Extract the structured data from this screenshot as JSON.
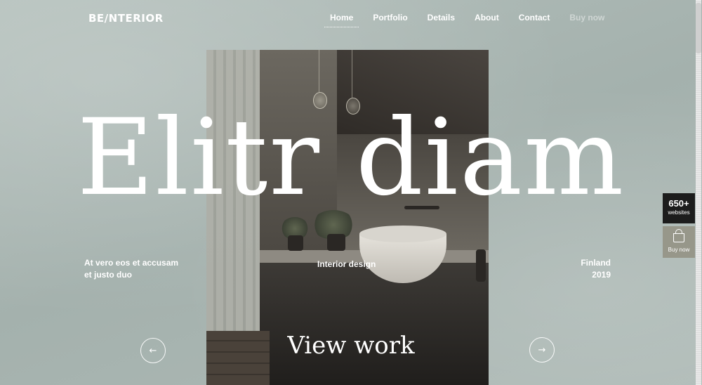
{
  "brand": {
    "logo": "BE/NTERIOR"
  },
  "nav": {
    "items": [
      "Home",
      "Portfolio",
      "Details",
      "About",
      "Contact",
      "Buy now"
    ],
    "active": "Home"
  },
  "hero": {
    "headline": "Elitr diam",
    "left_text": [
      "At vero eos et accusam",
      "et justo duo"
    ],
    "center_text": "Interior design",
    "right_text": [
      "Finland",
      "2019"
    ],
    "cta": "View work",
    "prev_icon": "arrow-left-icon",
    "next_icon": "arrow-right-icon",
    "prev_glyph": "←",
    "next_glyph": "→"
  },
  "side_widgets": {
    "websites_count": "650+",
    "websites_label": "websites",
    "buy_label": "Buy now",
    "buy_icon": "shopping-bag-icon"
  },
  "colors": {
    "background": "#a9b6b2",
    "text": "#ffffff",
    "badge_dark": "#1c1c1c",
    "badge_buy": "#97978a"
  }
}
